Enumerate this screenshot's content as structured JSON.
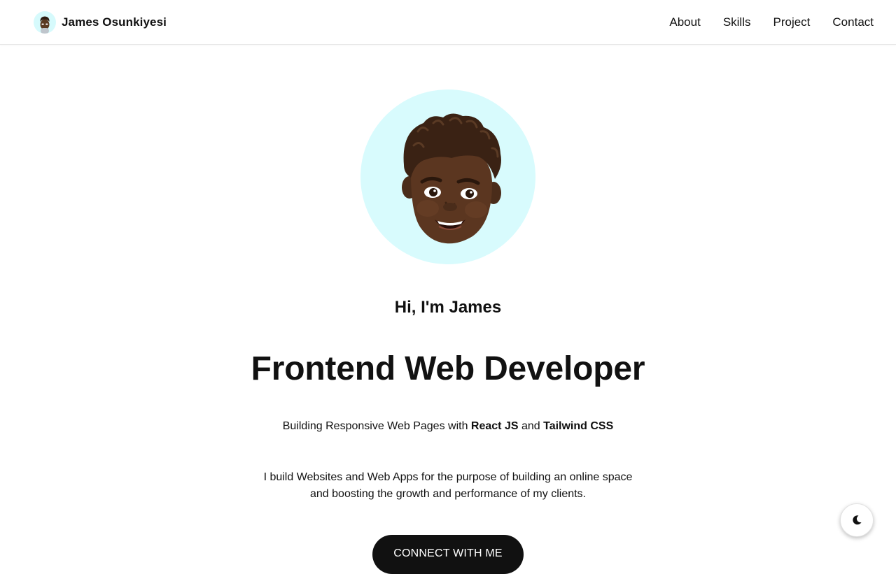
{
  "navbar": {
    "brand_name": "James Osunkiyesi",
    "links": [
      {
        "label": "About"
      },
      {
        "label": "Skills"
      },
      {
        "label": "Project"
      },
      {
        "label": "Contact"
      }
    ]
  },
  "hero": {
    "avatar_icon": "memoji-avatar",
    "avatar_bg": "#d8fbfd",
    "greeting": "Hi, I'm James",
    "headline": "Frontend Web Developer",
    "tagline": {
      "prefix": "Building Responsive Web Pages with ",
      "tech1": "React JS",
      "joiner": " and ",
      "tech2": "Tailwind CSS"
    },
    "description": "I build Websites and Web Apps for the purpose of building an online space and boosting the growth and performance of my clients.",
    "cta_label": "CONNECT WITH ME"
  },
  "theme_toggle": {
    "icon": "moon-icon"
  },
  "colors": {
    "text": "#111111",
    "avatar_bg": "#d8fbfd",
    "button_bg": "#111111",
    "button_text": "#ffffff"
  }
}
